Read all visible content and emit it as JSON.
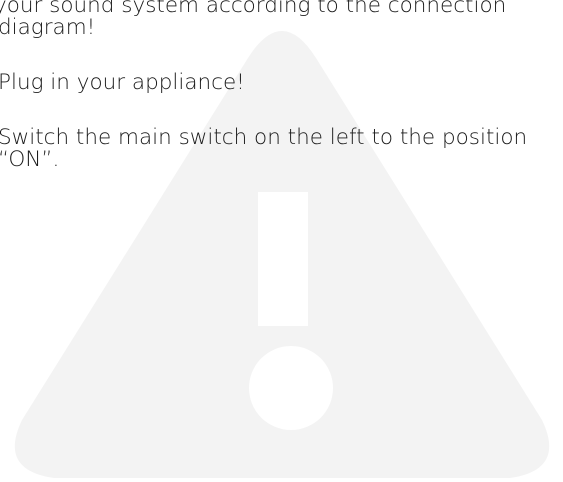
{
  "document": {
    "lines": [
      "your sound system according to the connection",
      "diagram!",
      "Plug in your appliance!",
      "Switch the main switch on the left to the position",
      "“ON”."
    ]
  },
  "colors": {
    "text": "#1a1a1a",
    "watermark": "#f3f3f3",
    "background": "#ffffff"
  },
  "icons": {
    "watermark": "warning-triangle-icon"
  }
}
